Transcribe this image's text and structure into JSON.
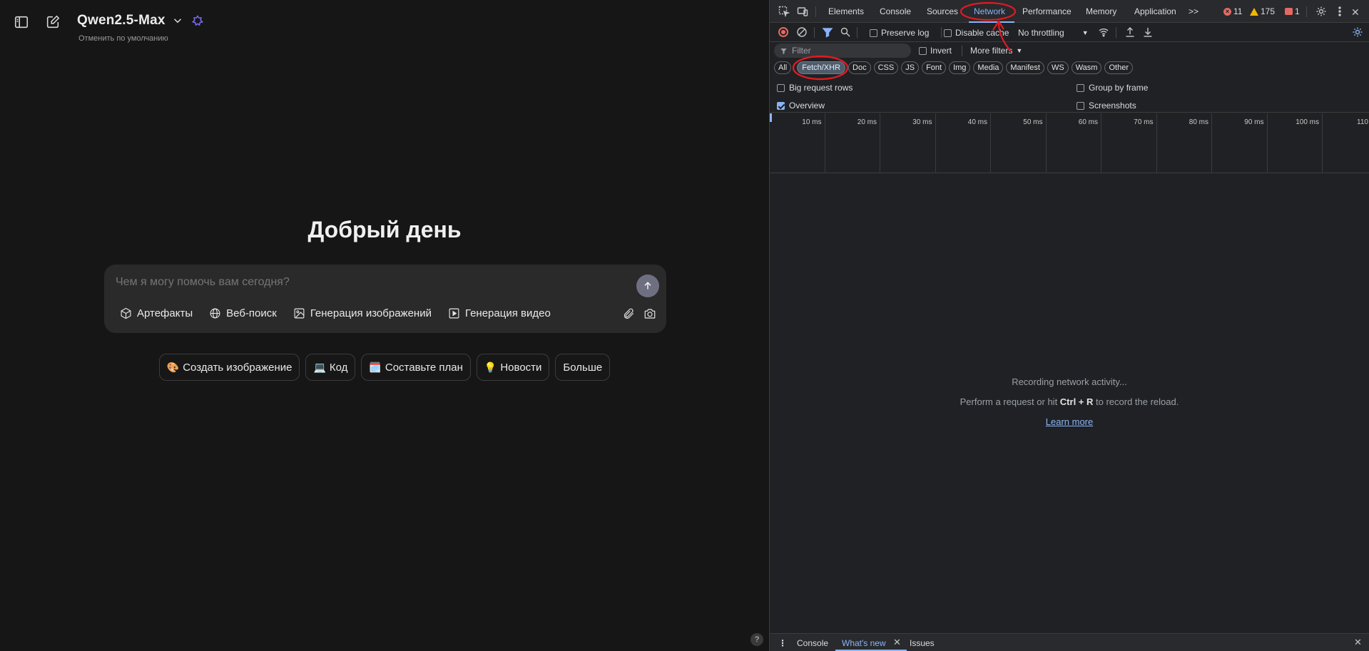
{
  "app": {
    "model_name": "Qwen2.5-Max",
    "model_subtitle": "Отменить по умолчанию",
    "greeting": "Добрый день",
    "composer": {
      "placeholder": "Чем я могу помочь вам сегодня?",
      "tools": [
        {
          "icon": "cube-icon",
          "label": "Артефакты"
        },
        {
          "icon": "globe-icon",
          "label": "Веб-поиск"
        },
        {
          "icon": "image-icon",
          "label": "Генерация изображений"
        },
        {
          "icon": "video-play-icon",
          "label": "Генерация видео"
        }
      ]
    },
    "chips": [
      {
        "emoji": "🎨",
        "label": "Создать изображение"
      },
      {
        "emoji": "💻",
        "label": "Код"
      },
      {
        "emoji": "🗓️",
        "label": "Составьте план"
      },
      {
        "emoji": "💡",
        "label": "Новости"
      },
      {
        "emoji": "",
        "label": "Больше"
      }
    ],
    "help": "?"
  },
  "devtools": {
    "tabs": [
      "Elements",
      "Console",
      "Sources",
      "Network",
      "Performance",
      "Memory",
      "Application"
    ],
    "active_tab": "Network",
    "more_tabs": ">>",
    "counts": {
      "errors": "11",
      "warnings": "175",
      "issues": "1"
    },
    "toolbar": {
      "preserve_log": "Preserve log",
      "disable_cache": "Disable cache",
      "throttling": "No throttling"
    },
    "filter": {
      "placeholder": "Filter",
      "invert": "Invert",
      "more_filters": "More filters"
    },
    "types": [
      "All",
      "Fetch/XHR",
      "Doc",
      "CSS",
      "JS",
      "Font",
      "Img",
      "Media",
      "Manifest",
      "WS",
      "Wasm",
      "Other"
    ],
    "active_type": "Fetch/XHR",
    "options": {
      "big_request_rows": "Big request rows",
      "group_by_frame": "Group by frame",
      "overview": "Overview",
      "screenshots": "Screenshots"
    },
    "timeline_ticks": [
      "10 ms",
      "20 ms",
      "30 ms",
      "40 ms",
      "50 ms",
      "60 ms",
      "70 ms",
      "80 ms",
      "90 ms",
      "100 ms",
      "110"
    ],
    "empty": {
      "line1": "Recording network activity...",
      "line2_prefix": "Perform a request or hit ",
      "line2_key": "Ctrl + R",
      "line2_suffix": " to record the reload.",
      "link": "Learn more"
    },
    "drawer": {
      "tabs": [
        "Console",
        "What's new",
        "Issues"
      ],
      "active": "What's new"
    }
  },
  "colors": {
    "app_bg": "#161616",
    "devtools_bg": "#202124",
    "accent_blue": "#8ab4f8",
    "annotation_red": "#e01b24"
  }
}
